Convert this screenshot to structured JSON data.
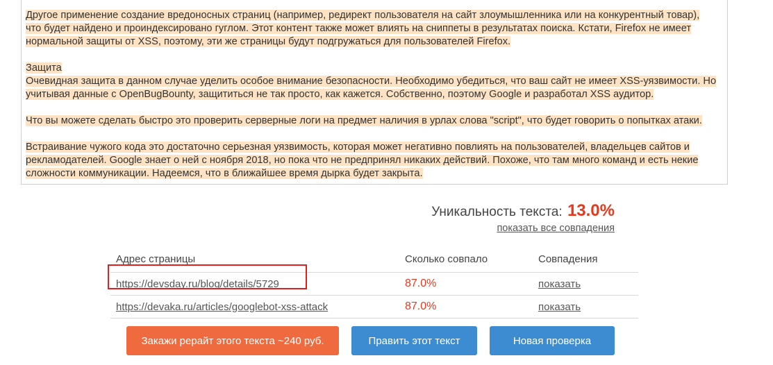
{
  "article": {
    "paragraphs": [
      {
        "lines": [
          "Другое применение создание вредоносных страниц (например, редирект пользователя на сайт злоумышленника или на конкурентный товар),",
          "что будет найдено и проиндексировано гуглом. Этот контент также может влиять на сниппеты в результатах поиска. Кстати, Firefox не имеет",
          "нормальной защиты от XSS, поэтому, эти же страницы будут подгружаться для пользователей Firefox."
        ]
      },
      {
        "heading": "Защита",
        "lines": [
          "Очевидная защита в данном случае уделить особое внимание безопасности. Необходимо убедиться, что ваш сайт не имеет XSS-уязвимости. Но",
          "учитывая данные с OpenBugBounty, защититься не так просто, как кажется. Собственно, поэтому Google и разработал XSS аудитор."
        ]
      },
      {
        "lines": [
          "Что вы можете сделать быстро это проверить серверные логи на предмет наличия в урлах слова \"script\", что будет говорить о попытках атаки."
        ]
      },
      {
        "lines": [
          "Встраивание чужого кода это достаточно серьезная уязвимость, которая может негативно повлиять на пользователей, владельцев сайтов и",
          "рекламодателей. Google знает о ней с ноября 2018, но пока что не предпринял никаких действий. Похоже, что там много команд и есть некие",
          "сложности коммуникации. Надеемся, что в ближайшее время дырка будет закрыта."
        ]
      }
    ]
  },
  "uniqueness": {
    "label": "Уникальность текста:",
    "value": "13.0%",
    "show_all_link": "показать все совпадения"
  },
  "table": {
    "headers": [
      "Адрес страницы",
      "Сколько совпало",
      "Совпадения"
    ],
    "rows": [
      {
        "url": "https://devsday.ru/blog/details/5729",
        "matched": "87.0%",
        "action": "показать",
        "highlighted": true
      },
      {
        "url": "https://devaka.ru/articles/googlebot-xss-attack",
        "matched": "87.0%",
        "action": "показать",
        "highlighted": false
      }
    ]
  },
  "buttons": {
    "rewrite": "Закажи рерайт этого текста ~240 руб.",
    "edit": "Править этот текст",
    "new_check": "Новая проверка"
  },
  "colors": {
    "highlight_bg": "#fde3c4",
    "accent_red": "#e8381c",
    "button_orange": "#ef6a3e",
    "button_blue": "#3d8bd1",
    "annotation_red": "#e02020"
  }
}
